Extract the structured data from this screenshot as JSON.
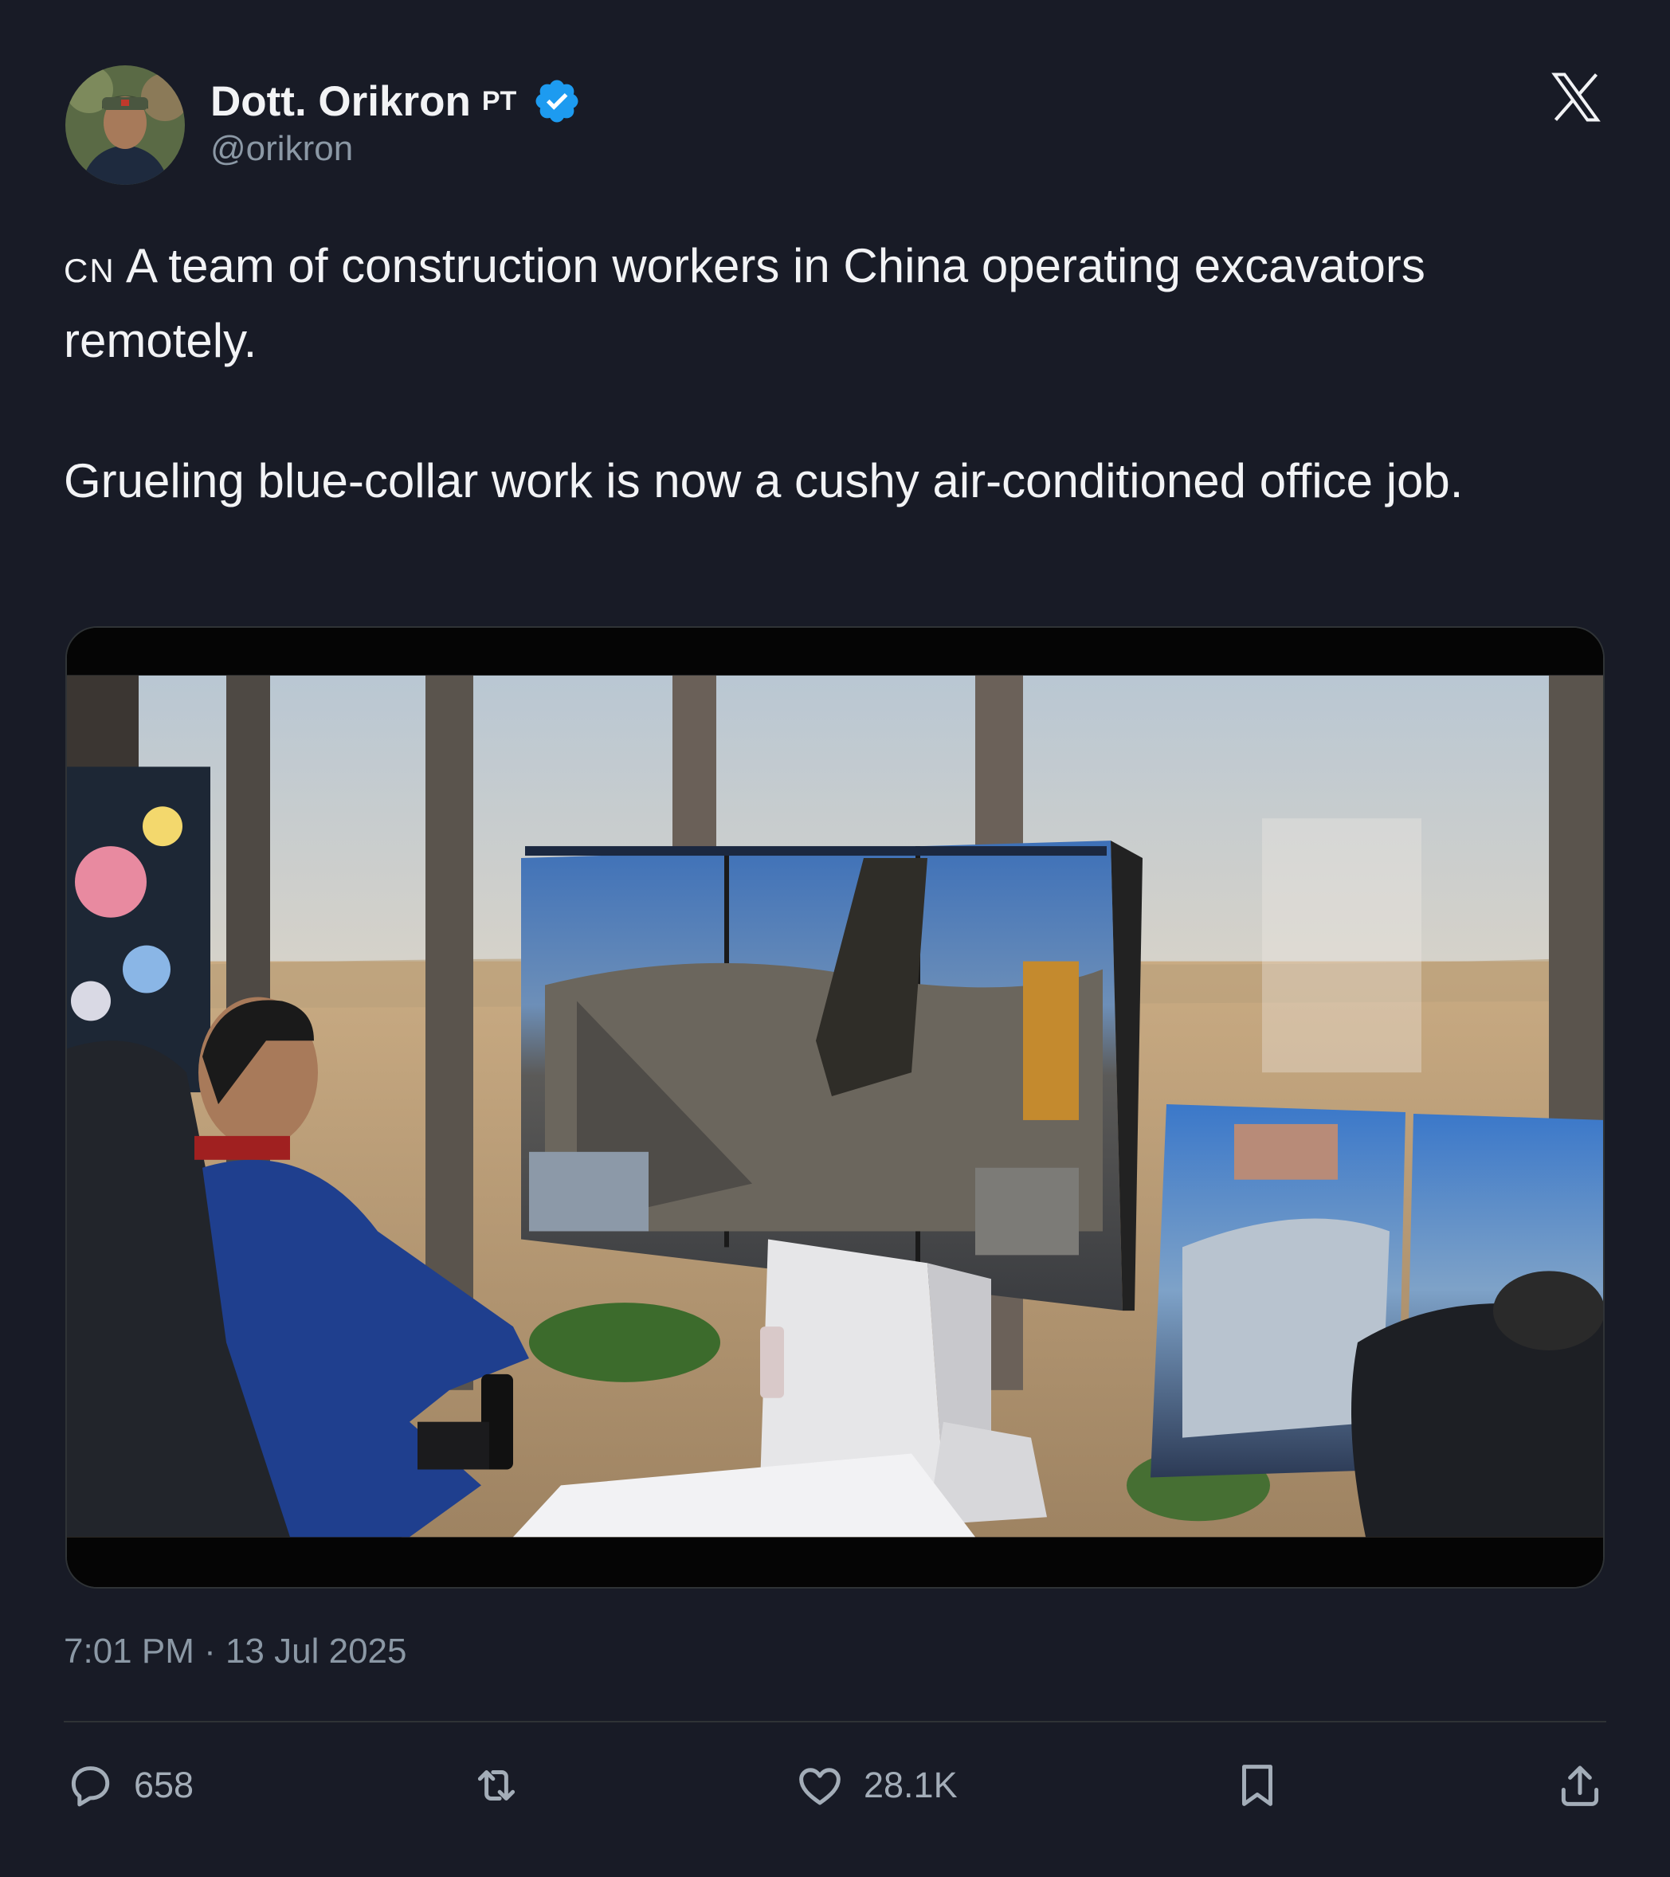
{
  "author": {
    "display_name": "Dott. Orikron",
    "flag": "PT",
    "handle": "@orikron"
  },
  "tweet": {
    "flag": "CN",
    "line1": "A team of construction workers in China operating excavators remotely.",
    "line2": "Grueling blue-collar work is now a cushy air-conditioned office job."
  },
  "timestamp": "7:01 PM · 13 Jul 2025",
  "actions": {
    "replies": "658",
    "likes": "28.1K"
  },
  "icons": [
    "verified-badge-icon",
    "x-logo-icon",
    "reply-icon",
    "retweet-icon",
    "like-icon",
    "bookmark-icon",
    "share-icon"
  ],
  "colors": {
    "background": "#181b26",
    "verified": "#1d9bf0",
    "muted": "#8b98a5"
  }
}
